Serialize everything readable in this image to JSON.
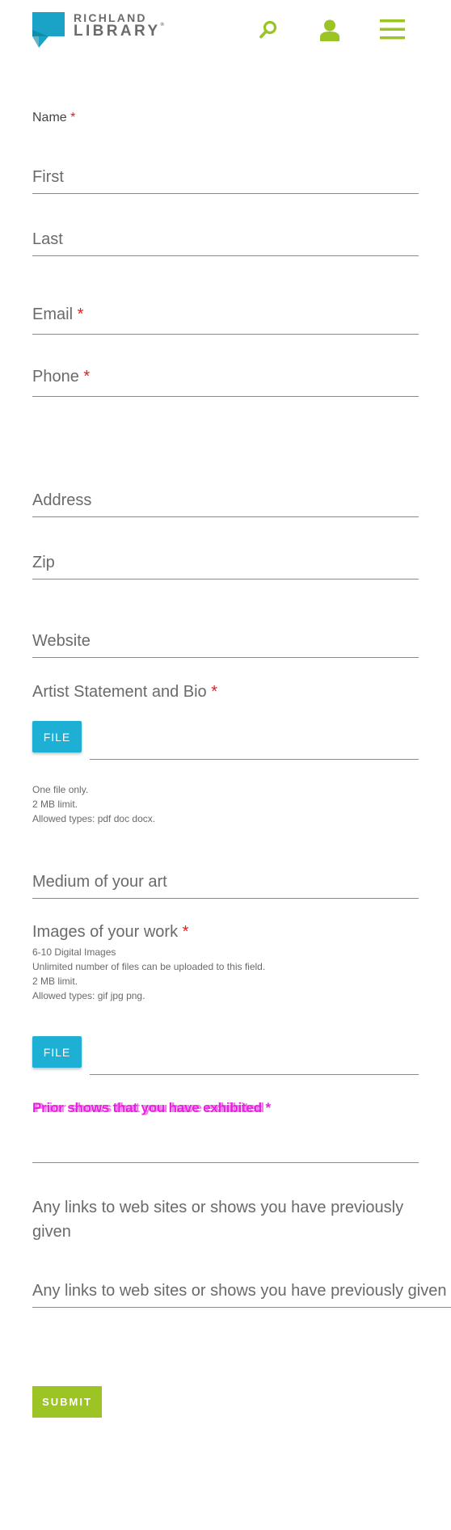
{
  "header": {
    "logo_line1": "RICHLAND",
    "logo_line2": "LIBRARY",
    "logo_reg": "®",
    "brand_teal": "#1aa3c6",
    "brand_green": "#9cc425",
    "icons": [
      "search-icon",
      "user-icon",
      "menu-icon"
    ]
  },
  "form": {
    "name_label": "Name",
    "required_mark": "*",
    "first_placeholder": "First",
    "last_placeholder": "Last",
    "email_label": "Email",
    "phone_label": "Phone",
    "address_placeholder": "Address",
    "zip_placeholder": "Zip",
    "website_placeholder": "Website",
    "statement_label": "Artist Statement and Bio",
    "file_button": "FILE",
    "statement_help": [
      "One file only.",
      "2 MB limit.",
      "Allowed types: pdf doc docx."
    ],
    "medium_placeholder": "Medium of your art",
    "images_label": "Images of your work",
    "images_help": [
      "6-10 Digital Images",
      "Unlimited number of files can be uploaded to this field.",
      "2 MB limit.",
      "Allowed types: gif jpg png."
    ],
    "prior_label_a": "Prior shows that you have exhibited",
    "prior_label_b": "Prior shows that you have exhibited",
    "links_label": "Any links to web sites or shows you have previously given",
    "links_placeholder": "Any links to web sites or shows you have previously given",
    "submit_label": "SUBMIT"
  }
}
